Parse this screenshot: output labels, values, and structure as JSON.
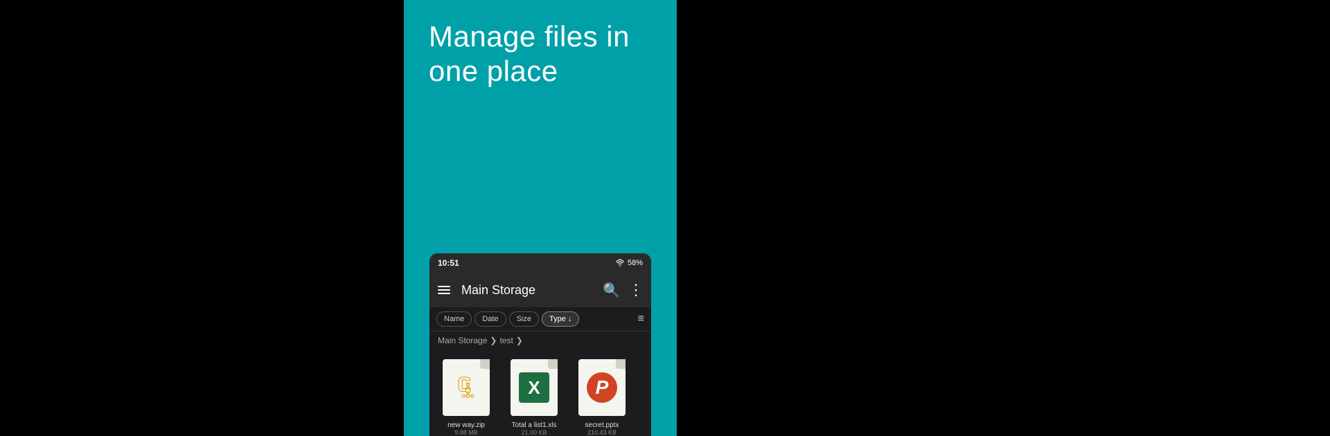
{
  "left": {
    "bg": "#000"
  },
  "center": {
    "bg": "#00a0a8",
    "headline_line1": "Manage files in",
    "headline_line2": "one place"
  },
  "phone": {
    "status_bar": {
      "time": "10:51",
      "battery": "58%"
    },
    "app_bar": {
      "title": "Main Storage",
      "menu_icon": "☰",
      "search_icon": "⌕",
      "more_icon": "⋮"
    },
    "sort_bar": {
      "buttons": [
        {
          "label": "Name",
          "active": false
        },
        {
          "label": "Date",
          "active": false
        },
        {
          "label": "Size",
          "active": false
        },
        {
          "label": "Type ↓",
          "active": true
        }
      ]
    },
    "breadcrumb": {
      "items": [
        "Main Storage",
        "test"
      ]
    },
    "files": [
      {
        "name": "new way.zip",
        "size": "9.88 MB",
        "type": "zip"
      },
      {
        "name": "Total a list1.xls",
        "size": "21.00 KB",
        "type": "xls"
      },
      {
        "name": "secret.pptx",
        "size": "210.43 KB",
        "type": "pptx"
      }
    ]
  }
}
